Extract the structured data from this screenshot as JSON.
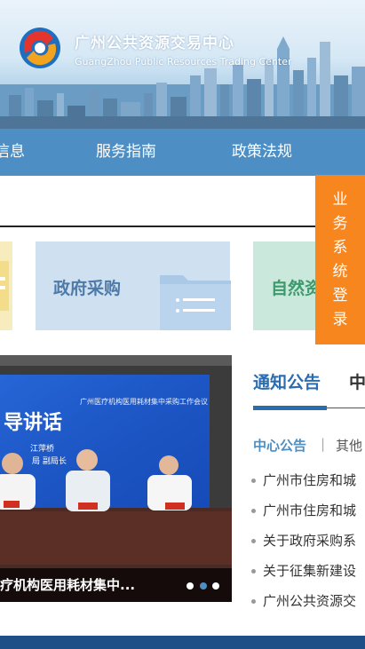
{
  "header": {
    "title_cn": "广州公共资源交易中心",
    "title_en": "GuangZhou Public Resources Trading Center"
  },
  "nav": {
    "items": [
      {
        "label": "信息"
      },
      {
        "label": "服务指南"
      },
      {
        "label": "政策法规"
      }
    ]
  },
  "login_float": {
    "chars": [
      "业",
      "务",
      "系",
      "统",
      "登",
      "录"
    ]
  },
  "categories": [
    {
      "label": "政府采购"
    },
    {
      "label": "自然资"
    }
  ],
  "slider": {
    "caption": "疗机构医用耗材集中...",
    "photo_text": {
      "banner_small": "广州医疗机构医用耗材集中采购工作会议",
      "banner_big": "导讲话",
      "nameplate_1": "江萍桥",
      "nameplate_2": "局  副局长"
    },
    "dots": 3,
    "active_dot": 1
  },
  "notices": {
    "tab_active": "通知公告",
    "tab_other": "中",
    "sub_active": "中心公告",
    "sub_separator": "|",
    "sub_other": "其他",
    "items": [
      {
        "title": "广州市住房和城"
      },
      {
        "title": "广州市住房和城"
      },
      {
        "title": "关于政府采购系"
      },
      {
        "title": "关于征集新建设"
      },
      {
        "title": "广州公共资源交"
      }
    ]
  },
  "colors": {
    "nav_bg": "#4d8fc4",
    "login_bg": "#f7861e",
    "accent": "#2b6cae"
  }
}
